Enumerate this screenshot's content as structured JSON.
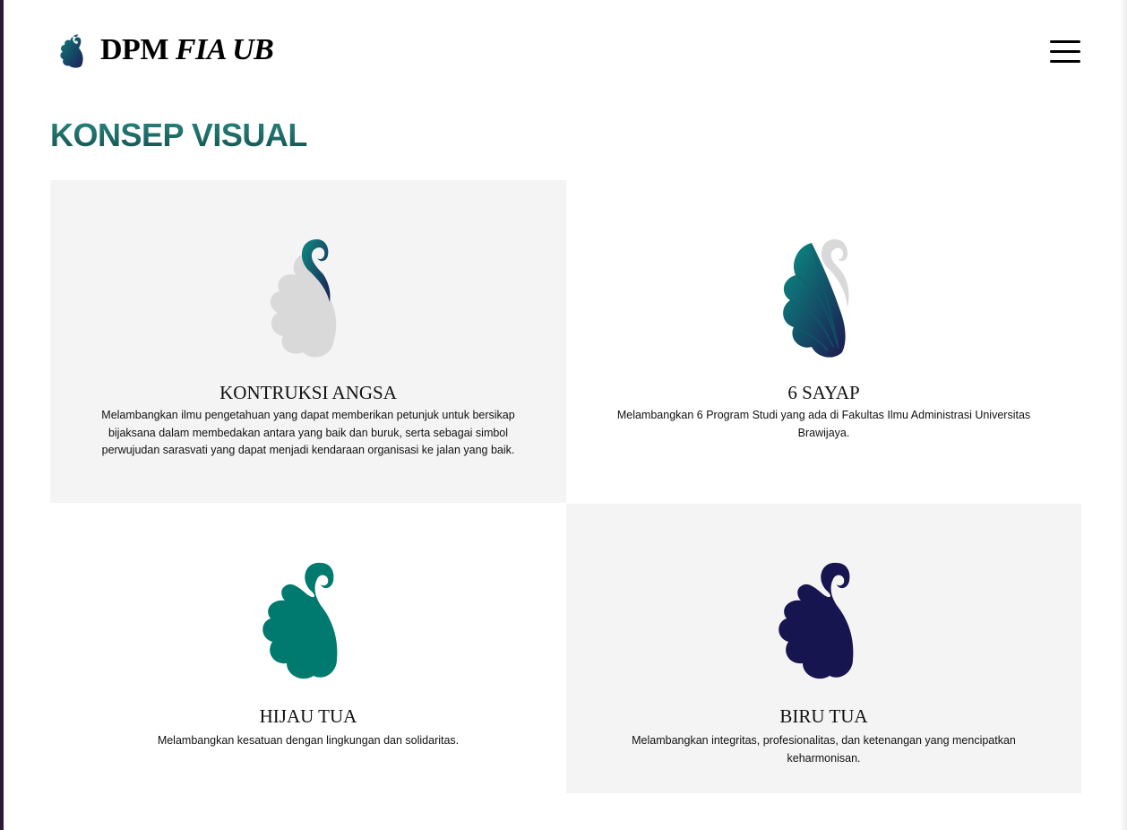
{
  "header": {
    "brand_main": "DPM",
    "brand_italic": "FIA UB",
    "logo_icon": "swan-logo-icon",
    "menu_icon": "hamburger-menu-icon"
  },
  "section": {
    "title": "KONSEP VISUAL"
  },
  "cards": [
    {
      "title": "KONTRUKSI ANGSA",
      "description": "Melambangkan ilmu pengetahuan yang dapat memberikan petunjuk untuk bersikap bijaksana dalam membedakan antara yang baik dan buruk, serta sebagai simbol perwujudan sarasvati yang dapat menjadi kendaraan organisasi ke jalan yang baik.",
      "icon": "swan-construction-icon"
    },
    {
      "title": "6 SAYAP",
      "description": "Melambangkan 6 Program Studi yang ada di Fakultas Ilmu Administrasi Universitas Brawijaya.",
      "icon": "six-wings-icon"
    },
    {
      "title": "HIJAU TUA",
      "description": "Melambangkan kesatuan dengan lingkungan dan solidaritas.",
      "icon": "green-swan-icon",
      "color": "#007a6e"
    },
    {
      "title": "BIRU TUA",
      "description": "Melambangkan integritas, profesionalitas, dan ketenangan yang mencipatkan keharmonisan.",
      "icon": "navy-swan-icon",
      "color": "#17154f"
    }
  ],
  "colors": {
    "title_gradient_top": "#2a8a80",
    "title_gradient_bottom": "#124f4f",
    "card_shade": "#f4f4f4",
    "logo_grey": "#d9d9d9"
  }
}
